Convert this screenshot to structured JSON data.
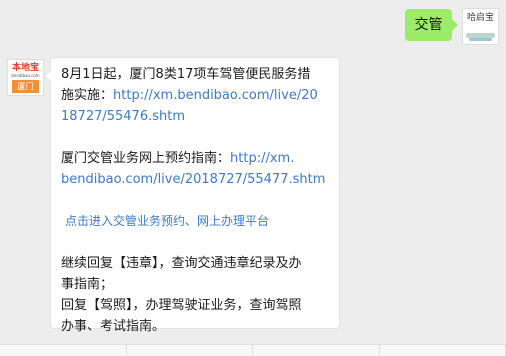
{
  "user_message": {
    "text": "交管",
    "avatar_text": "哈启宝"
  },
  "bot": {
    "avatar_brand": "本地宝",
    "avatar_site": "bendibao.com",
    "avatar_city": "厦门"
  },
  "reply": {
    "p1_line1": "8月1日起，厦门8类17项车驾管便民服务措",
    "p1_line2_prefix": "施实施：",
    "p1_link_part1": "http://xm.bendibao.com/live/20",
    "p1_link_part2": "18727/55476.shtm",
    "p2_line1_prefix": "厦门交管业务网上预约指南：",
    "p2_link_part1": "http://xm.",
    "p2_link_part2": "bendibao.com/live/2018727/55477.shtm",
    "cta_link": "点击进入交管业务预约、网上办理平台",
    "p3_line1": "继续回复【违章】，查询交通违章纪录及办",
    "p3_line2": "事指南；",
    "p3_line3": "回复【驾照】，办理驾驶证业务，查询驾照",
    "p3_line4": "办事、考试指南。"
  },
  "colors": {
    "chat_background": "#ededed",
    "user_bubble": "#9eea6a",
    "link": "#3e7bbf",
    "bot_city_badge": "#f29132",
    "bot_brand": "#e0432b"
  }
}
